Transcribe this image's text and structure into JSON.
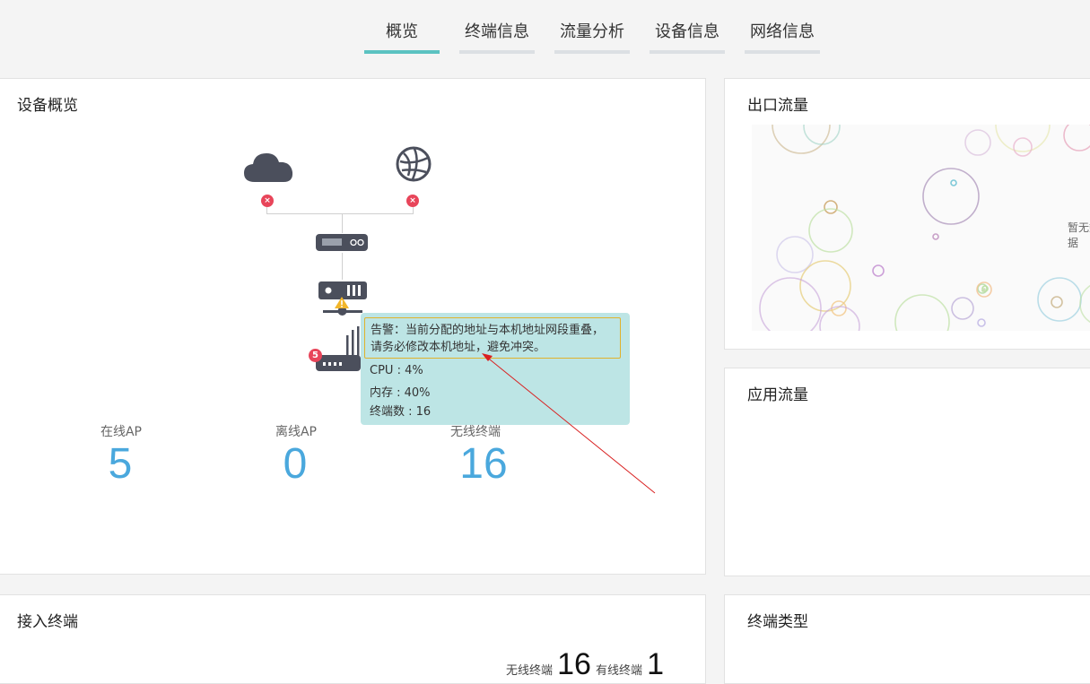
{
  "nav": {
    "tabs": [
      {
        "label": "概览",
        "active": true
      },
      {
        "label": "终端信息",
        "active": false
      },
      {
        "label": "流量分析",
        "active": false
      },
      {
        "label": "设备信息",
        "active": false
      },
      {
        "label": "网络信息",
        "active": false
      }
    ]
  },
  "overview": {
    "title": "设备概览",
    "ap_badge": "5",
    "err_mark": "×",
    "stats": [
      {
        "label": "在线AP",
        "value": "5"
      },
      {
        "label": "离线AP",
        "value": "0"
      },
      {
        "label": "无线终端",
        "value": "16"
      }
    ],
    "tooltip": {
      "warning": "告警：当前分配的地址与本机地址网段重叠，请务必修改本机地址，避免冲突。",
      "cpu": "CPU : 4%",
      "memory": "内存 : 40%",
      "clients": "终端数 : 16"
    }
  },
  "egress": {
    "title": "出口流量",
    "no_data": "暂无数据"
  },
  "app_traffic": {
    "title": "应用流量"
  },
  "clients_panel": {
    "title": "接入终端",
    "wireless_label": "无线终端",
    "wireless_value": "16",
    "wired_label": "有线终端",
    "wired_value": "1"
  },
  "client_type": {
    "title": "终端类型"
  },
  "colors": {
    "accent": "#5bc2c1",
    "stat": "#4aa8dd",
    "error": "#e8455a",
    "tooltip_bg": "#bde5e5"
  }
}
